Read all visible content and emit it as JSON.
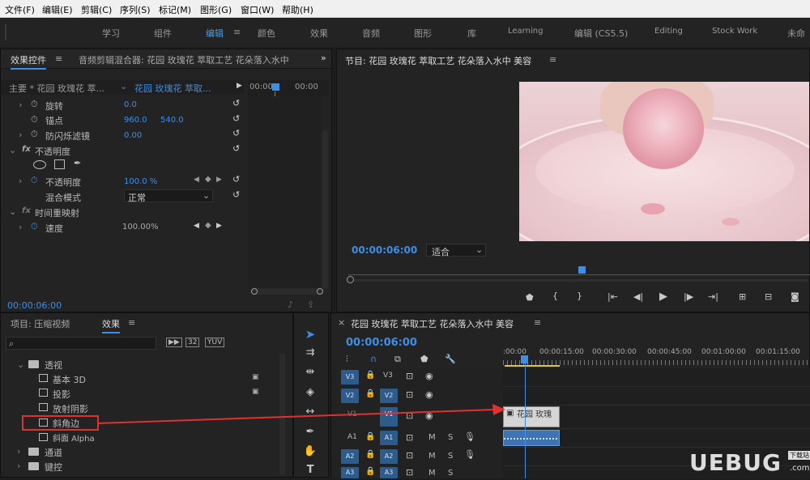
{
  "menu": [
    "文件(F)",
    "编辑(E)",
    "剪辑(C)",
    "序列(S)",
    "标记(M)",
    "图形(G)",
    "窗口(W)",
    "帮助(H)"
  ],
  "workspaces": [
    "学习",
    "组件",
    "编辑",
    "颜色",
    "效果",
    "音频",
    "图形",
    "库",
    "Learning",
    "编辑 (CS5.5)",
    "Editing",
    "Stock Work",
    "未命"
  ],
  "workspace_menu_glyph": "≡",
  "effect_controls": {
    "tab_label": "效果控件",
    "tab_menu": "≡",
    "mixer_tab": "音频剪辑混合器: 花园 玫瑰花 萃取工艺 花朵落入水中",
    "overflow": "»",
    "master_label": "主要 * 花园 玫瑰花 萃...",
    "clip_label": "花园 玫瑰花 萃取...",
    "ruler_start": "00:00",
    "ruler_end": "00:00",
    "timecode": "00:00:06:00",
    "props": {
      "rotation": {
        "label": "旋转",
        "value": "0.0"
      },
      "anchor": {
        "label": "锚点",
        "x": "960.0",
        "y": "540.0"
      },
      "antiflicker": {
        "label": "防闪烁滤镜",
        "value": "0.00"
      },
      "opacity_group": {
        "label": "不透明度"
      },
      "opacity": {
        "label": "不透明度",
        "value": "100.0 %"
      },
      "blend": {
        "label": "混合模式",
        "value": "正常"
      },
      "time_remap": {
        "label": "时间重映射"
      },
      "speed": {
        "label": "速度",
        "value": "100.00%"
      }
    }
  },
  "program": {
    "title": "节目: 花园 玫瑰花 萃取工艺 花朵落入水中 美容",
    "menu": "≡",
    "timecode": "00:00:06:00",
    "fit": "适合"
  },
  "project": {
    "tab_label": "项目: 压缩视频",
    "effects_tab": "效果",
    "tab_menu": "≡",
    "tree": [
      {
        "label": "透视",
        "kind": "folder",
        "level": 1
      },
      {
        "label": "基本 3D",
        "kind": "effect",
        "level": 2
      },
      {
        "label": "投影",
        "kind": "effect",
        "level": 2
      },
      {
        "label": "放射阴影",
        "kind": "effect",
        "level": 2
      },
      {
        "label": "斜角边",
        "kind": "effect",
        "level": 2
      },
      {
        "label": "斜面 Alpha",
        "kind": "effect",
        "level": 2
      },
      {
        "label": "通道",
        "kind": "folder",
        "level": 1
      },
      {
        "label": "键控",
        "kind": "folder",
        "level": 1
      }
    ]
  },
  "timeline": {
    "close": "×",
    "title": "花园 玫瑰花 萃取工艺 花朵落入水中 美容",
    "menu": "≡",
    "timecode": "00:00:06:00",
    "ruler": [
      ":00:00",
      "00:00:15:00",
      "00:00:30:00",
      "00:00:45:00",
      "00:01:00:00",
      "00:01:15:00"
    ],
    "video_tracks": [
      {
        "id": "V3",
        "name": "V3"
      },
      {
        "id": "V2",
        "name": "V2"
      },
      {
        "id": "V1",
        "name": "V1"
      }
    ],
    "audio_tracks": [
      {
        "id": "A1",
        "name": "A1"
      },
      {
        "id": "A2",
        "name": "A2"
      },
      {
        "id": "A3",
        "name": "A3"
      }
    ],
    "clip_label": "花园 玫瑰",
    "mute_label": "M",
    "solo_label": "S"
  },
  "watermark": {
    "brand": "UEBUG",
    "tag": "下载站",
    "domain": ".com"
  },
  "colors": {
    "accent": "#3e8ee6",
    "annotation": "#e03030",
    "track_active": "#2e5c8a"
  }
}
